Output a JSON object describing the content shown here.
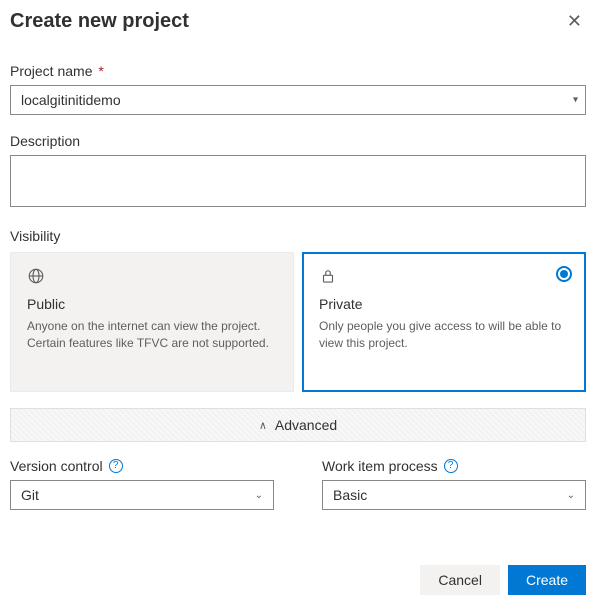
{
  "header": {
    "title": "Create new project"
  },
  "projectName": {
    "label": "Project name",
    "required": "*",
    "value": "localgitinitidemo"
  },
  "description": {
    "label": "Description",
    "value": ""
  },
  "visibility": {
    "label": "Visibility",
    "options": [
      {
        "key": "public",
        "title": "Public",
        "desc": "Anyone on the internet can view the project. Certain features like TFVC are not supported.",
        "selected": false
      },
      {
        "key": "private",
        "title": "Private",
        "desc": "Only people you give access to will be able to view this project.",
        "selected": true
      }
    ]
  },
  "advanced": {
    "label": "Advanced",
    "versionControl": {
      "label": "Version control",
      "value": "Git"
    },
    "workItemProcess": {
      "label": "Work item process",
      "value": "Basic"
    }
  },
  "footer": {
    "cancel": "Cancel",
    "create": "Create"
  }
}
